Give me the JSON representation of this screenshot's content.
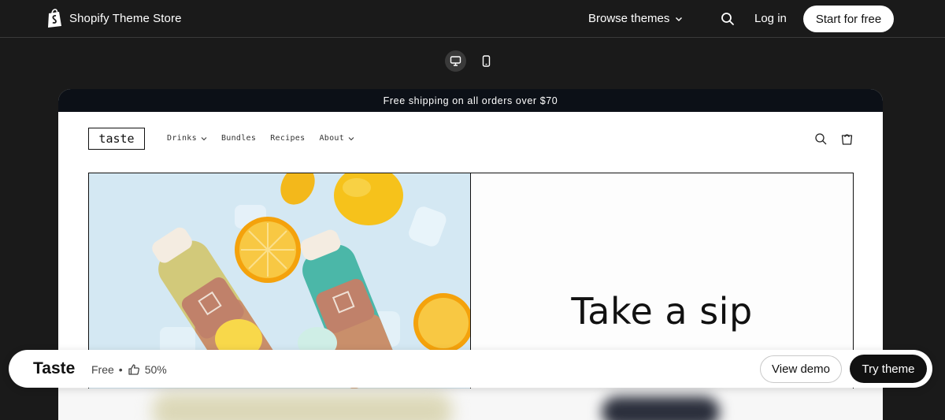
{
  "topnav": {
    "brand": "Shopify Theme Store",
    "browse_label": "Browse themes",
    "login_label": "Log in",
    "start_label": "Start for free"
  },
  "preview": {
    "announcement": "Free shipping on all orders over $70",
    "shop_logo": "taste",
    "nav": [
      {
        "label": "Drinks",
        "has_dropdown": true
      },
      {
        "label": "Bundles",
        "has_dropdown": false
      },
      {
        "label": "Recipes",
        "has_dropdown": false
      },
      {
        "label": "About",
        "has_dropdown": true
      }
    ],
    "hero_heading": "Take a sip"
  },
  "bottom_bar": {
    "theme_name": "Taste",
    "price": "Free",
    "separator": "•",
    "rating": "50%",
    "view_demo_label": "View demo",
    "try_theme_label": "Try theme"
  },
  "icons": {
    "brand": "shopify-bag-icon",
    "browse_dropdown": "chevron-down-icon",
    "search": "search-icon",
    "desktop": "desktop-icon",
    "mobile": "mobile-icon",
    "cart": "cart-icon",
    "rating": "thumbs-up-icon"
  },
  "colors": {
    "page_bg": "#1a1a1a",
    "announcement_bg": "#0c1017",
    "primary_button": "#111111"
  },
  "device_toggle": {
    "active": "desktop"
  }
}
